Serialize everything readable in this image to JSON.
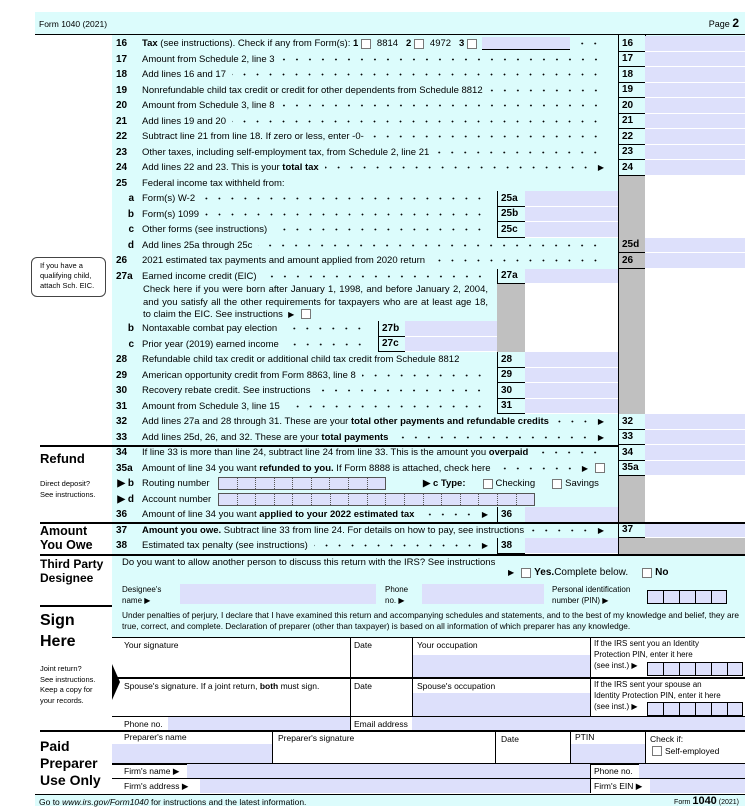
{
  "header": {
    "form": "Form 1040 (2021)",
    "page_label": "Page ",
    "page_num": "2"
  },
  "lines": [
    {
      "num": "16",
      "seg": [
        {
          "t": "Tax",
          "b": 1
        },
        {
          "t": " (see instructions). Check if any from Form(s): "
        },
        {
          "t": "1",
          "b": 1
        },
        {
          "cb": 1
        },
        {
          "t": " 8814   "
        },
        {
          "t": "2",
          "b": 1
        },
        {
          "cb": 1
        },
        {
          "t": " 4972   "
        },
        {
          "t": "3",
          "b": 1
        },
        {
          "cb": 1
        },
        {
          "field": 1
        }
      ],
      "box": "16"
    },
    {
      "num": "17",
      "seg": [
        {
          "t": "Amount from Schedule 2, line 3"
        }
      ],
      "box": "17"
    },
    {
      "num": "18",
      "seg": [
        {
          "t": "Add lines 16 and 17"
        }
      ],
      "box": "18"
    },
    {
      "num": "19",
      "seg": [
        {
          "t": "Nonrefundable child tax credit or credit for other dependents from Schedule 8812"
        }
      ],
      "box": "19"
    },
    {
      "num": "20",
      "seg": [
        {
          "t": "Amount from Schedule 3, line 8"
        }
      ],
      "box": "20"
    },
    {
      "num": "21",
      "seg": [
        {
          "t": "Add lines 19 and 20"
        }
      ],
      "box": "21"
    },
    {
      "num": "22",
      "seg": [
        {
          "t": "Subtract line 21 from line 18. If zero or less, enter -0-"
        }
      ],
      "box": "22"
    },
    {
      "num": "23",
      "seg": [
        {
          "t": "Other taxes, including self-employment tax, from Schedule 2, line 21"
        }
      ],
      "box": "23"
    },
    {
      "num": "24",
      "seg": [
        {
          "t": "Add lines 22 and 23. This is your "
        },
        {
          "t": "total tax",
          "b": 1
        }
      ],
      "arrow": 1,
      "box": "24"
    },
    {
      "num": "25",
      "seg": [
        {
          "t": "Federal income tax withheld from:"
        }
      ],
      "nodots": 1
    },
    {
      "num": "a",
      "seg": [
        {
          "t": "Form(s) W-2"
        }
      ],
      "sub_box": "25a"
    },
    {
      "num": "b",
      "seg": [
        {
          "t": "Form(s) 1099"
        }
      ],
      "sub_box": "25b"
    },
    {
      "num": "c",
      "seg": [
        {
          "t": "Other forms (see instructions)"
        }
      ],
      "sub_box": "25c"
    },
    {
      "num": "d",
      "seg": [
        {
          "t": "Add lines 25a through 25c"
        }
      ],
      "box": "25d"
    },
    {
      "num": "26",
      "seg": [
        {
          "t": "2021 estimated tax payments and amount applied from 2020 return"
        }
      ],
      "box": "26"
    },
    {
      "num": "27a",
      "seg": [
        {
          "t": "Earned income credit (EIC)"
        }
      ],
      "sub_box": "27a"
    },
    {
      "para": "Check here if you were born after January 1, 1998, and before January 2, 2004, and you satisfy all the other requirements for taxpayers who are at least age 18, to claim the EIC. See instructions"
    },
    {
      "num": "b",
      "seg": [
        {
          "t": "Nontaxable combat pay election"
        }
      ],
      "inner_box": "27b"
    },
    {
      "num": "c",
      "seg": [
        {
          "t": "Prior year (2019) earned income"
        }
      ],
      "inner_box": "27c"
    },
    {
      "num": "28",
      "seg": [
        {
          "t": "Refundable child tax credit or additional child tax credit from Schedule 8812"
        }
      ],
      "sub_box": "28",
      "nodots": 1
    },
    {
      "num": "29",
      "seg": [
        {
          "t": "American opportunity credit from Form 8863, line 8"
        }
      ],
      "sub_box": "29"
    },
    {
      "num": "30",
      "seg": [
        {
          "t": "Recovery rebate credit. See instructions"
        }
      ],
      "sub_box": "30"
    },
    {
      "num": "31",
      "seg": [
        {
          "t": "Amount from Schedule 3, line 15"
        }
      ],
      "sub_box": "31"
    },
    {
      "num": "32",
      "seg": [
        {
          "t": "Add lines 27a and 28 through 31. These are your "
        },
        {
          "t": "total other payments and refundable credits",
          "b": 1
        }
      ],
      "arrow": 1,
      "box": "32"
    },
    {
      "num": "33",
      "seg": [
        {
          "t": "Add lines 25d, 26, and 32. These are your "
        },
        {
          "t": "total payments",
          "b": 1
        }
      ],
      "arrow": 1,
      "box": "33"
    },
    {
      "num": "34",
      "seg": [
        {
          "t": "If line 33 is more than line 24, subtract line 24 from line 33. This is the amount you "
        },
        {
          "t": "overpaid",
          "b": 1
        }
      ],
      "box": "34"
    },
    {
      "num": "35a",
      "seg": [
        {
          "t": "Amount of line 34 you want "
        },
        {
          "t": "refunded to you.",
          "b": 1
        },
        {
          "t": " If Form 8888 is attached, check here"
        }
      ],
      "arrow": 1,
      "cb_end": 1,
      "box": "35a"
    },
    {
      "num": "▶ b",
      "seg": [
        {
          "t": "Routing number"
        }
      ],
      "routing": 1
    },
    {
      "num": "▶ d",
      "seg": [
        {
          "t": "Account number"
        }
      ],
      "account": 1
    },
    {
      "num": "36",
      "seg": [
        {
          "t": "Amount of line 34 you want "
        },
        {
          "t": "applied to your 2022 estimated tax",
          "b": 1
        }
      ],
      "arrow": 1,
      "sub_box": "36"
    },
    {
      "num": "37",
      "seg": [
        {
          "t": "Amount you owe.",
          "b": 1
        },
        {
          "t": " Subtract line 33 from line 24. For details on how to pay, see instructions"
        }
      ],
      "arrow": 1,
      "box": "37"
    },
    {
      "num": "38",
      "seg": [
        {
          "t": "Estimated tax penalty (see instructions)"
        }
      ],
      "arrow": 1,
      "sub_box": "38"
    }
  ],
  "routing": {
    "type_label": "▶ c Type:",
    "checking": "Checking",
    "savings": "Savings"
  },
  "eic_note": "If you have a\nqualifying child,\nattach Sch. EIC.",
  "sections": {
    "refund": "Refund",
    "direct_deposit": "Direct deposit?\nSee instructions.",
    "amount_owe": "Amount\nYou Owe",
    "third_party": "Third Party\nDesignee",
    "sign": "Sign\nHere",
    "joint": "Joint return?\nSee instructions.\nKeep a copy for\nyour records.",
    "paid": "Paid\nPreparer\nUse Only"
  },
  "designee": {
    "question": "Do you want to allow another person to discuss this return with the IRS? See instructions",
    "yes": "Yes.",
    "yes_rest": " Complete below.",
    "no": "No",
    "name_label": "Designee's\nname ▶",
    "phone_label": "Phone\nno. ▶",
    "pin_label": "Personal identification\nnumber (PIN) ▶"
  },
  "sign": {
    "perjury": "Under penalties of perjury, I declare that I have examined this return and accompanying schedules and statements, and to the best of my knowledge and belief, they are true, correct, and complete. Declaration of preparer (other than taxpayer) is based on all information of which preparer has any knowledge.",
    "your_signature": "Your signature",
    "date": "Date",
    "your_occupation": "Your occupation",
    "ip_pin": "If the IRS sent you an Identity\nProtection PIN, enter it here\n(see inst.) ▶",
    "spouse_sig_a": "Spouse's signature. If a joint return, ",
    "spouse_sig_b": "both",
    "spouse_sig_c": " must sign.",
    "spouse_occupation": "Spouse's occupation",
    "spouse_ip_pin": "If the IRS sent your spouse an\nIdentity Protection PIN, enter it here\n(see inst.) ▶",
    "phone": "Phone no.",
    "email": "Email address"
  },
  "preparer": {
    "name": "Preparer's name",
    "signature": "Preparer's signature",
    "date": "Date",
    "ptin": "PTIN",
    "check_if": "Check if:",
    "self_employed": "Self-employed",
    "firm_name": "Firm's name ▶",
    "firm_phone": "Phone no.",
    "firm_address": "Firm's address ▶",
    "firm_ein": "Firm's EIN ▶"
  },
  "footer": {
    "left_a": "Go to ",
    "link": "www.irs.gov/Form1040",
    "left_b": " for instructions and the latest information.",
    "form_word": "Form ",
    "form_num": "1040",
    "year": " (2021)"
  },
  "colors": {
    "background": "#dcfcfc",
    "field": "#dde0fb",
    "shade": "#c0c0c0"
  }
}
